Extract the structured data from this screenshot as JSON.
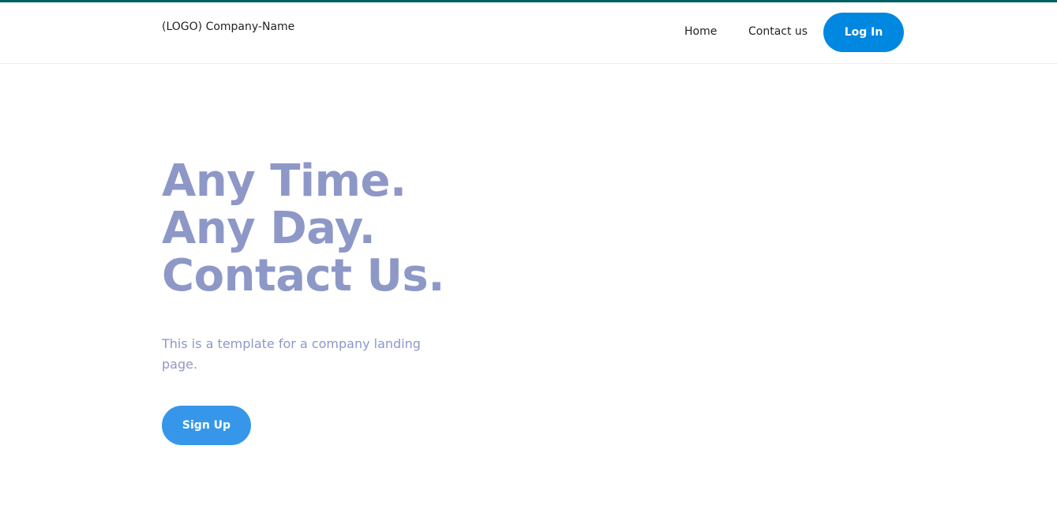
{
  "header": {
    "brand": "(LOGO) Company-Name",
    "nav": {
      "home": "Home",
      "contact": "Contact us"
    },
    "login_label": "Log In"
  },
  "hero": {
    "title_lines": [
      "Any Time.",
      "Any Day.",
      "Contact Us."
    ],
    "subtitle": "This is a template for a company landing page.",
    "signup_label": "Sign Up"
  },
  "colors": {
    "top_accent": "#005f63",
    "primary_button": "#0088e0",
    "signup_button": "#3697ea",
    "hero_text": "#8e98c7"
  }
}
